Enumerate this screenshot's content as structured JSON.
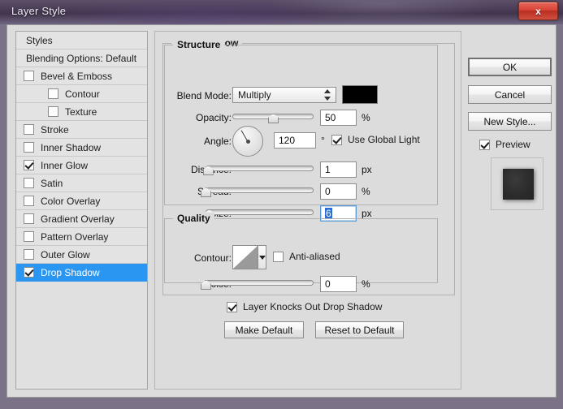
{
  "window": {
    "title": "Layer Style",
    "close_label": "x"
  },
  "styles_panel": {
    "header": "Styles",
    "blending_option": "Blending Options: Default",
    "items": [
      {
        "label": "Bevel & Emboss",
        "checked": false,
        "indent": false,
        "selected": false
      },
      {
        "label": "Contour",
        "checked": false,
        "indent": true,
        "selected": false
      },
      {
        "label": "Texture",
        "checked": false,
        "indent": true,
        "selected": false
      },
      {
        "label": "Stroke",
        "checked": false,
        "indent": false,
        "selected": false
      },
      {
        "label": "Inner Shadow",
        "checked": false,
        "indent": false,
        "selected": false
      },
      {
        "label": "Inner Glow",
        "checked": true,
        "indent": false,
        "selected": false
      },
      {
        "label": "Satin",
        "checked": false,
        "indent": false,
        "selected": false
      },
      {
        "label": "Color Overlay",
        "checked": false,
        "indent": false,
        "selected": false
      },
      {
        "label": "Gradient Overlay",
        "checked": false,
        "indent": false,
        "selected": false
      },
      {
        "label": "Pattern Overlay",
        "checked": false,
        "indent": false,
        "selected": false
      },
      {
        "label": "Outer Glow",
        "checked": false,
        "indent": false,
        "selected": false
      },
      {
        "label": "Drop Shadow",
        "checked": true,
        "indent": false,
        "selected": true
      }
    ],
    "selection_color": "#2b95f2"
  },
  "main": {
    "group_title": "Drop Shadow",
    "structure": {
      "legend": "Structure",
      "blend_mode": {
        "label": "Blend Mode:",
        "value": "Multiply",
        "color": "#000000"
      },
      "opacity": {
        "label": "Opacity:",
        "value": "50",
        "unit": "%",
        "percent": 50
      },
      "angle": {
        "label": "Angle:",
        "value": "120",
        "unit": "°",
        "degrees": 120
      },
      "use_global_light": {
        "label": "Use Global Light",
        "checked": true
      },
      "distance": {
        "label": "Distance:",
        "value": "1",
        "unit": "px",
        "percent": 2
      },
      "spread": {
        "label": "Spread:",
        "value": "0",
        "unit": "%",
        "percent": 0
      },
      "size": {
        "label": "Size:",
        "value": "6",
        "unit": "px",
        "percent": 3,
        "focused": true,
        "selected_text": true
      }
    },
    "quality": {
      "legend": "Quality",
      "contour": {
        "label": "Contour:"
      },
      "anti_aliased": {
        "label": "Anti-aliased",
        "checked": false
      },
      "noise": {
        "label": "Noise:",
        "value": "0",
        "unit": "%",
        "percent": 0
      }
    },
    "knocks_out": {
      "label": "Layer Knocks Out Drop Shadow",
      "checked": true
    },
    "make_default_label": "Make Default",
    "reset_default_label": "Reset to Default"
  },
  "right": {
    "ok_label": "OK",
    "cancel_label": "Cancel",
    "new_style_label": "New Style...",
    "preview": {
      "label": "Preview",
      "checked": true
    }
  }
}
